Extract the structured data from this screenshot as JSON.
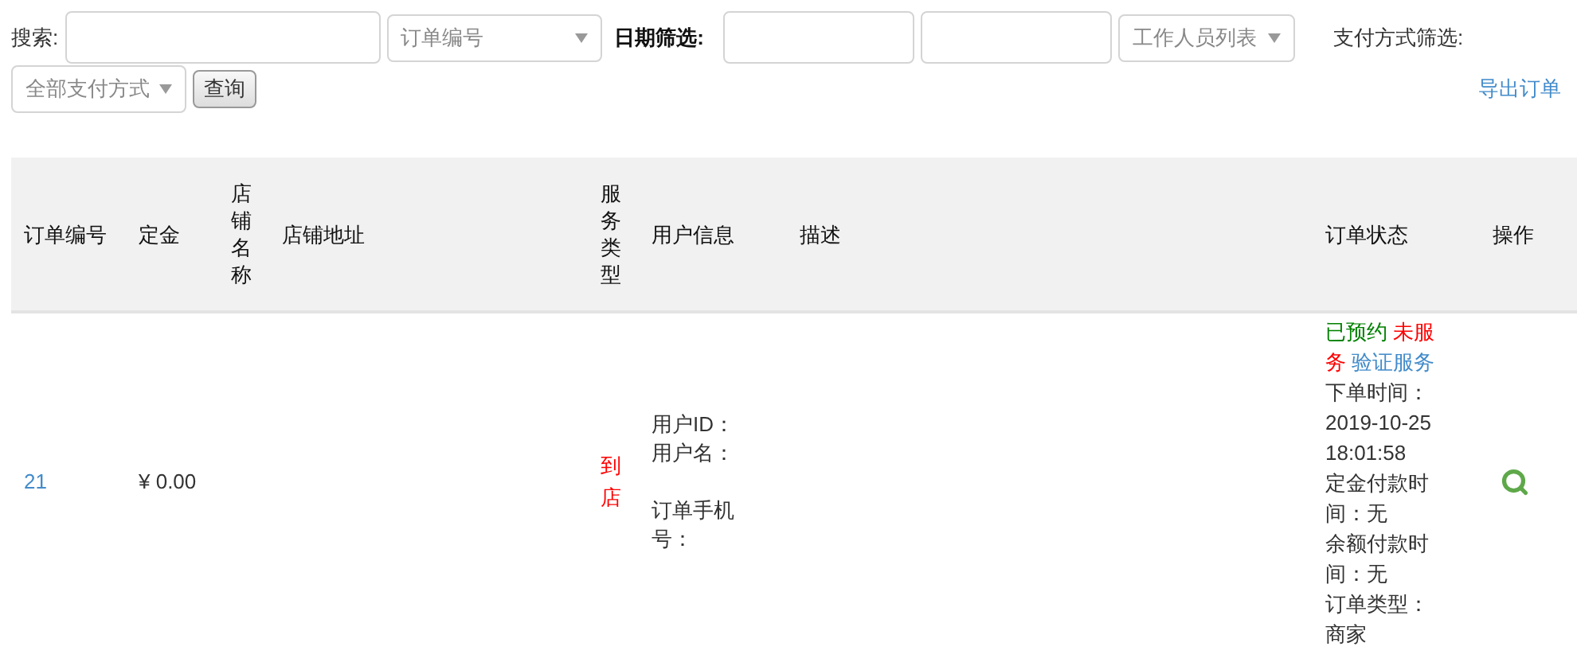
{
  "filters": {
    "search_label": "搜索:",
    "search_type": {
      "value": "订单编号"
    },
    "date_label": "日期筛选:",
    "staff_select": {
      "value": "工作人员列表"
    },
    "payment_label": "支付方式筛选:",
    "payment_select": {
      "value": "全部支付方式"
    },
    "query_button": "查询",
    "export_link": "导出订单"
  },
  "table": {
    "columns": [
      "订单编号",
      "定金",
      "店铺名称",
      "店铺地址",
      "服务类型",
      "用户信息",
      "描述",
      "订单状态",
      "操作"
    ],
    "rows": [
      {
        "order_no": "21",
        "deposit": "¥ 0.00",
        "service_type": "到店",
        "user_info": [
          "用户ID：",
          "用户名："
        ],
        "phone_label": "订单手机号：",
        "status_tags": [
          {
            "text": "已预约",
            "color": "#008000"
          },
          {
            "text": "未服务",
            "color": "#ff0000"
          }
        ],
        "verify_link": "验证服务",
        "details": [
          "下单时间：2019-10-25 18:01:58",
          "定金付款时间：无",
          "余额付款时间：无",
          "订单类型：商家"
        ]
      }
    ]
  }
}
